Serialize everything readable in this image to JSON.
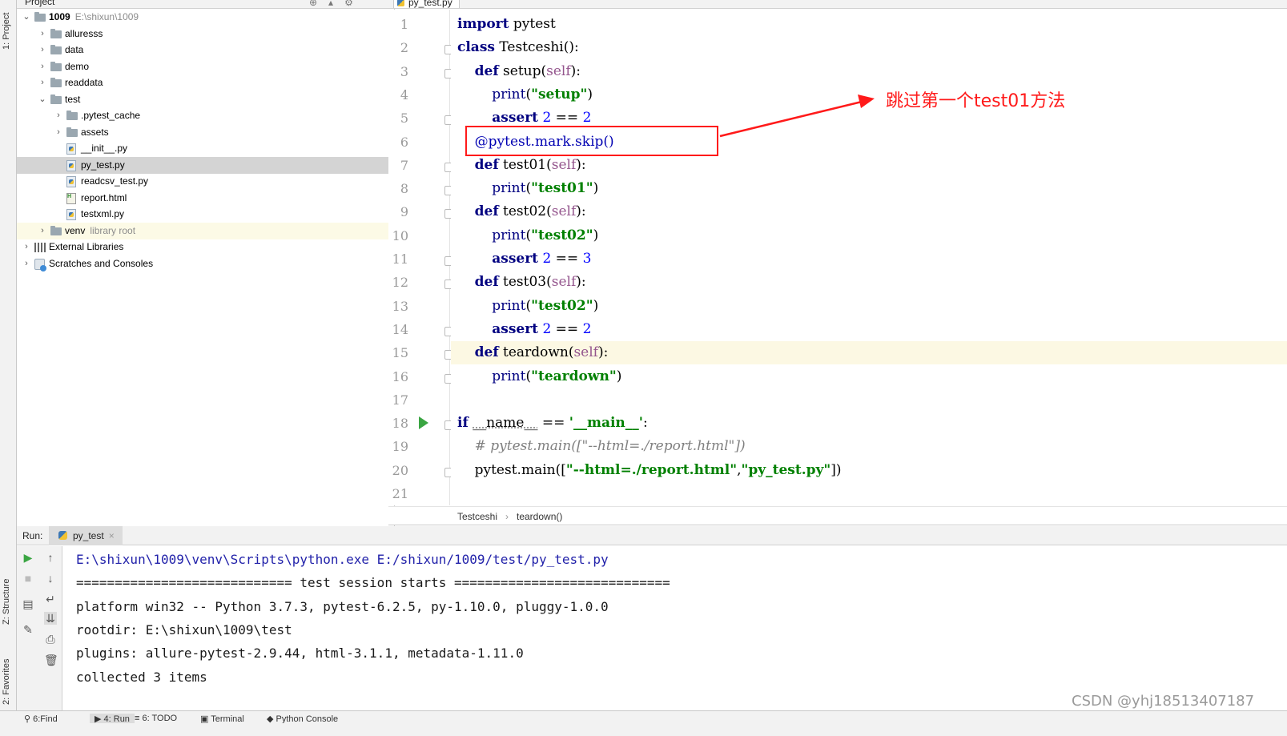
{
  "left_strip": {
    "project_tab": "1: Project",
    "structure_tab": "Z: Structure",
    "favorites_tab": "2: Favorites"
  },
  "project_panel": {
    "title": "Project",
    "tree": [
      {
        "name": "1009",
        "detail": "E:\\shixun\\1009",
        "type": "folder",
        "depth": 0,
        "expanded": true
      },
      {
        "name": "alluresss",
        "type": "folder",
        "depth": 1,
        "expanded": false
      },
      {
        "name": "data",
        "type": "folder",
        "depth": 1,
        "expanded": false
      },
      {
        "name": "demo",
        "type": "folder",
        "depth": 1,
        "expanded": false
      },
      {
        "name": "readdata",
        "type": "folder",
        "depth": 1,
        "expanded": false
      },
      {
        "name": "test",
        "type": "folder",
        "depth": 1,
        "expanded": true
      },
      {
        "name": ".pytest_cache",
        "type": "folder",
        "depth": 2,
        "expanded": false
      },
      {
        "name": "assets",
        "type": "folder",
        "depth": 2,
        "expanded": false
      },
      {
        "name": "__init__.py",
        "type": "py",
        "depth": 2
      },
      {
        "name": "py_test.py",
        "type": "py",
        "depth": 2,
        "selected": true
      },
      {
        "name": "readcsv_test.py",
        "type": "py",
        "depth": 2
      },
      {
        "name": "report.html",
        "type": "html",
        "depth": 2
      },
      {
        "name": "testxml.py",
        "type": "py",
        "depth": 2
      },
      {
        "name": "venv",
        "detail": "library root",
        "type": "folder",
        "depth": 1,
        "expanded": false
      },
      {
        "name": "External Libraries",
        "type": "lib",
        "depth": 0,
        "expanded": false
      },
      {
        "name": "Scratches and Consoles",
        "type": "scratch",
        "depth": 0,
        "expanded": false
      }
    ]
  },
  "editor": {
    "tab_label": "py_test.py",
    "highlighted_line": 15,
    "lines": [
      {
        "n": "1",
        "code": "import pytest"
      },
      {
        "n": "2",
        "code": "class Testceshi():"
      },
      {
        "n": "3",
        "code": "    def setup(self):"
      },
      {
        "n": "4",
        "code": "        print(\"setup\")"
      },
      {
        "n": "5",
        "code": "        assert 2 == 2"
      },
      {
        "n": "6",
        "code": "    @pytest.mark.skip()"
      },
      {
        "n": "7",
        "code": "    def test01(self):"
      },
      {
        "n": "8",
        "code": "        print(\"test01\")"
      },
      {
        "n": "9",
        "code": "    def test02(self):"
      },
      {
        "n": "10",
        "code": "        print(\"test02\")"
      },
      {
        "n": "11",
        "code": "        assert 2 == 3"
      },
      {
        "n": "12",
        "code": "    def test03(self):"
      },
      {
        "n": "13",
        "code": "        print(\"test02\")"
      },
      {
        "n": "14",
        "code": "        assert 2 == 2"
      },
      {
        "n": "15",
        "code": "    def teardown(self):"
      },
      {
        "n": "16",
        "code": "        print(\"teardown\")"
      },
      {
        "n": "17",
        "code": ""
      },
      {
        "n": "18",
        "code": "if __name__ == '__main__':"
      },
      {
        "n": "19",
        "code": "    # pytest.main([\"--html=./report.html\"])"
      },
      {
        "n": "20",
        "code": "    pytest.main([\"--html=./report.html\",\"py_test.py\"])"
      },
      {
        "n": "21",
        "code": ""
      }
    ]
  },
  "annotation": {
    "text": "跳过第一个test01方法",
    "color": "#ff1a1a"
  },
  "breadcrumb": {
    "class_name": "Testceshi",
    "method_name": "teardown()"
  },
  "run_panel": {
    "label": "Run:",
    "tab_label": "py_test",
    "output": [
      "E:\\shixun\\1009\\venv\\Scripts\\python.exe E:/shixun/1009/test/py_test.py",
      "============================ test session starts ============================",
      "platform win32 -- Python 3.7.3, pytest-6.2.5, py-1.10.0, pluggy-1.0.0",
      "rootdir: E:\\shixun\\1009\\test",
      "plugins: allure-pytest-2.9.44, html-3.1.1, metadata-1.11.0",
      "collected 3 items"
    ]
  },
  "watermark": "CSDN @yhj18513407187",
  "icons": {
    "folder": "folder-icon",
    "python_file": "python-file-icon",
    "html_file": "html-file-icon",
    "run": "run-icon",
    "bulb": "intention-bulb-icon"
  },
  "colors": {
    "keyword": "#000080",
    "string": "#008000",
    "number": "#0000ff",
    "self": "#94558d",
    "highlight_line": "#fcf8e3",
    "selection": "#d4d4d4"
  }
}
